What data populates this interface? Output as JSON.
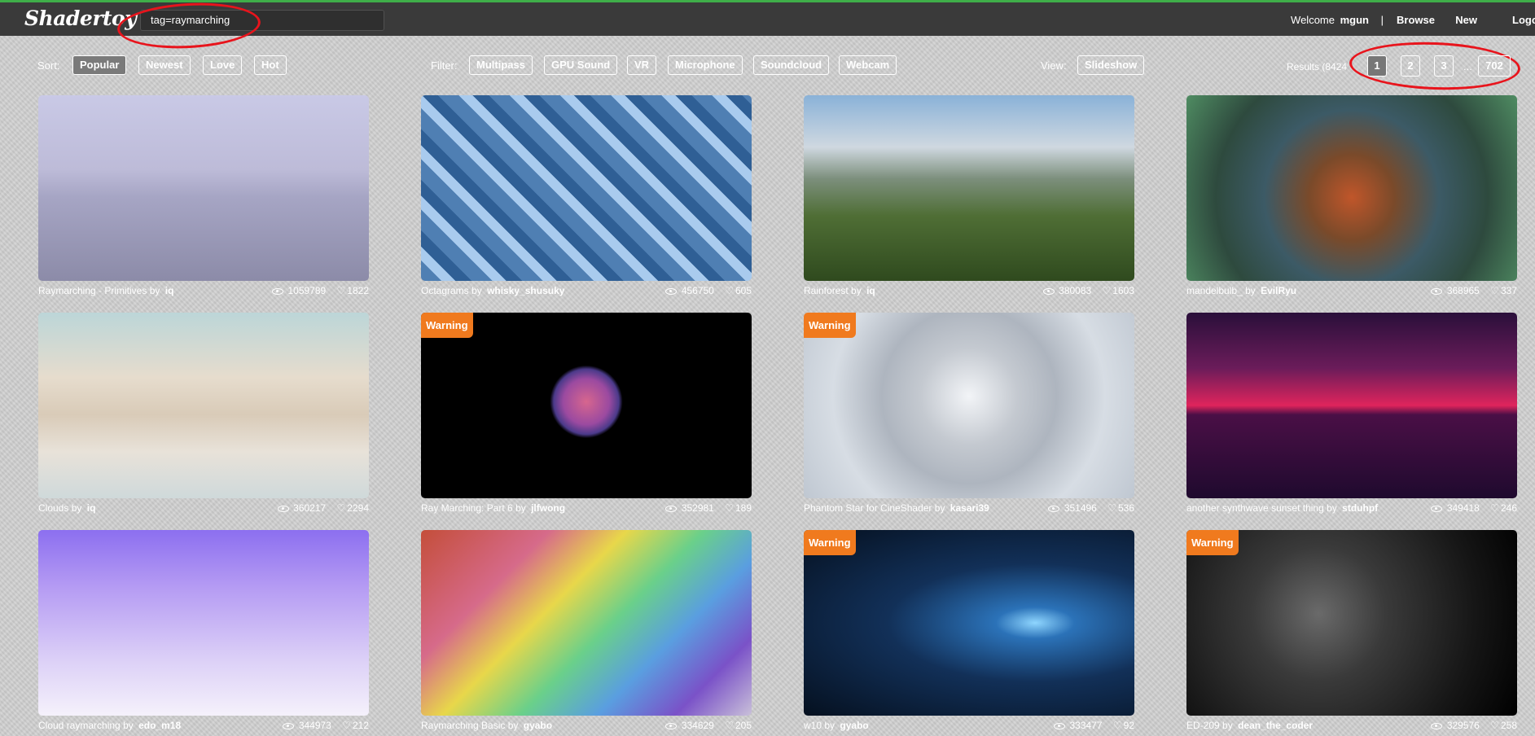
{
  "app": {
    "logo": "Shadertoy"
  },
  "search": {
    "value": "tag=raymarching"
  },
  "nav": {
    "welcome": "Welcome",
    "user": "mgun",
    "sep": "|",
    "browse": "Browse",
    "new": "New",
    "logout": "Logo"
  },
  "controls": {
    "sort_label": "Sort:",
    "sort": [
      "Popular",
      "Newest",
      "Love",
      "Hot"
    ],
    "filter_label": "Filter:",
    "filter": [
      "Multipass",
      "GPU Sound",
      "VR",
      "Microphone",
      "Soundcloud",
      "Webcam"
    ],
    "view_label": "View:",
    "view": "Slideshow",
    "results": "Results (8424",
    "pages": [
      "1",
      "2",
      "3",
      "702"
    ],
    "dots": "..."
  },
  "icons": {
    "views": "eye-icon",
    "likes": "heart-icon"
  },
  "colors": {
    "warning": "#f07a1e",
    "topbar": "#3a3a3a",
    "accent": "#3fae49",
    "annotation": "#e8141c"
  },
  "cards": [
    {
      "title": "Raymarching - Primitives",
      "by": "by",
      "author": "iq",
      "views": "1059789",
      "likes": "1822",
      "warning": ""
    },
    {
      "title": "Octagrams",
      "by": "by",
      "author": "whisky_shusuky",
      "views": "456750",
      "likes": "605",
      "warning": ""
    },
    {
      "title": "Rainforest",
      "by": "by",
      "author": "iq",
      "views": "380083",
      "likes": "1603",
      "warning": ""
    },
    {
      "title": "mandelbulb_",
      "by": "by",
      "author": "EvilRyu",
      "views": "368965",
      "likes": "337",
      "warning": ""
    },
    {
      "title": "Clouds",
      "by": "by",
      "author": "iq",
      "views": "360217",
      "likes": "2294",
      "warning": ""
    },
    {
      "title": "Ray Marching: Part 6",
      "by": "by",
      "author": "jlfwong",
      "views": "352981",
      "likes": "189",
      "warning": "Warning"
    },
    {
      "title": "Phantom Star for CineShader",
      "by": "by",
      "author": "kasari39",
      "views": "351496",
      "likes": "536",
      "warning": "Warning"
    },
    {
      "title": "another synthwave sunset thing",
      "by": "by",
      "author": "stduhpf",
      "views": "349418",
      "likes": "246",
      "warning": ""
    },
    {
      "title": "Cloud raymarching",
      "by": "by",
      "author": "edo_m18",
      "views": "344973",
      "likes": "212",
      "warning": ""
    },
    {
      "title": "Raymarching Basic",
      "by": "by",
      "author": "gyabo",
      "views": "334629",
      "likes": "205",
      "warning": ""
    },
    {
      "title": "w10",
      "by": "by",
      "author": "gyabo",
      "views": "333477",
      "likes": "92",
      "warning": "Warning"
    },
    {
      "title": "ED-209",
      "by": "by",
      "author": "dean_the_coder",
      "views": "329576",
      "likes": "258",
      "warning": "Warning"
    }
  ]
}
